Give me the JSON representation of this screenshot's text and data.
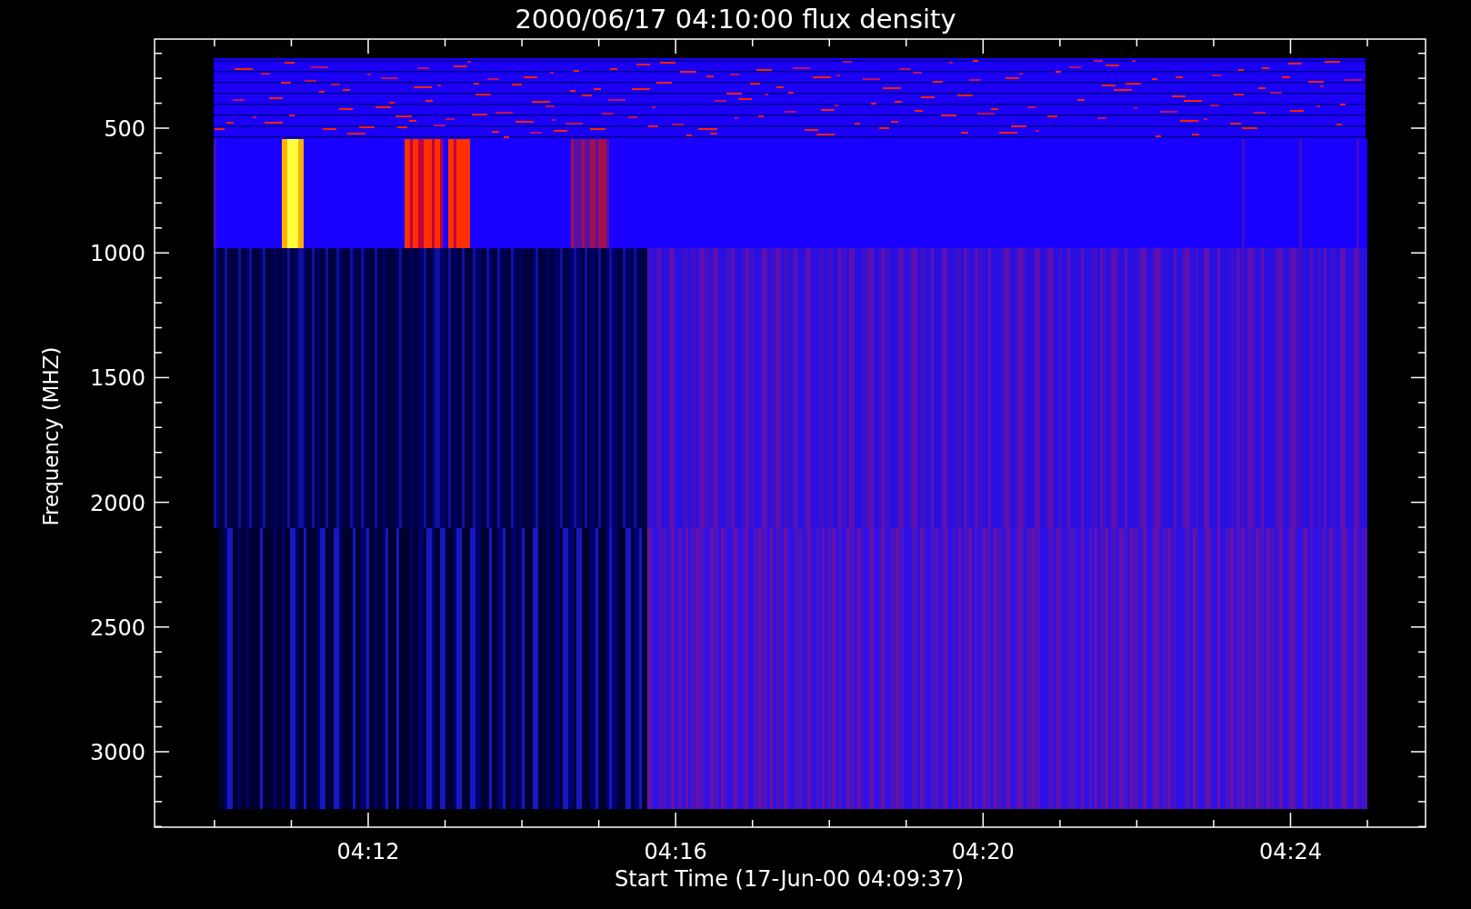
{
  "title": "2000/06/17 04:10:00 flux density",
  "y_axis": {
    "label": "Frequency (MHZ)",
    "tick_labels": [
      "500",
      "1000",
      "1500",
      "2000",
      "2500",
      "3000"
    ]
  },
  "x_axis": {
    "label": "Start Time (17-Jun-00 04:09:37)",
    "tick_labels": [
      "04:12",
      "04:16",
      "04:20",
      "04:24"
    ]
  }
}
